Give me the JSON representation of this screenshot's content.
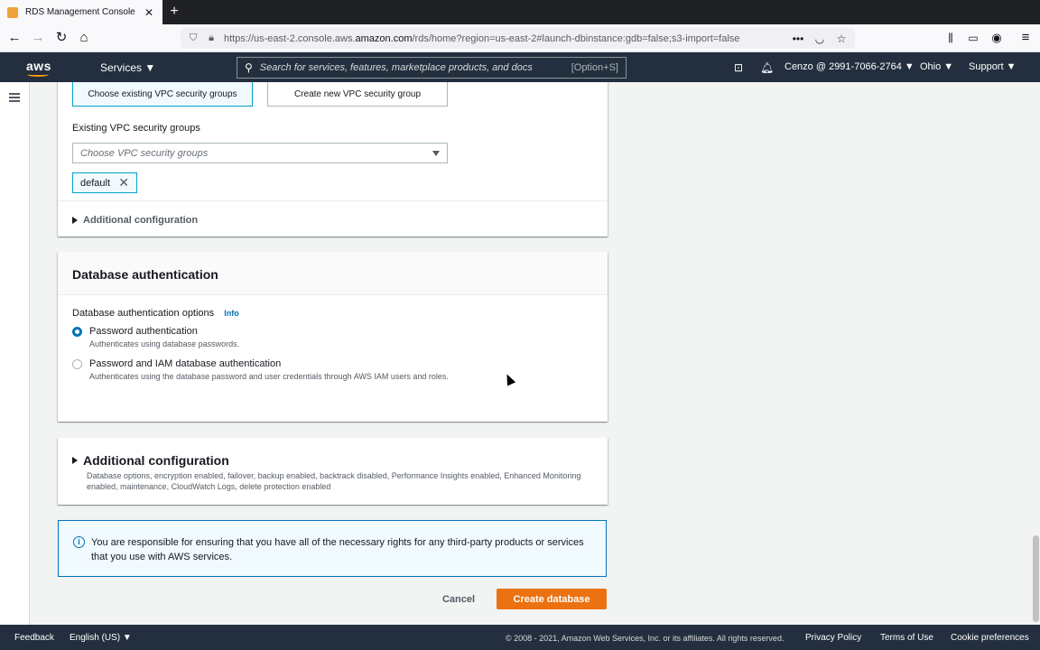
{
  "browser": {
    "tab_title": "RDS Management Console",
    "url_prefix": "https://us-east-2.console.aws.",
    "url_domain": "amazon.com",
    "url_suffix": "/rds/home?region=us-east-2#launch-dbinstance:gdb=false;s3-import=false"
  },
  "aws_header": {
    "logo": "aws",
    "services": "Services ▼",
    "search_placeholder": "Search for services, features, marketplace products, and docs",
    "search_shortcut": "[Option+S]",
    "account": "Cenzo @ 2991-7066-2764 ▼",
    "region": "Ohio ▼",
    "support": "Support ▼"
  },
  "security_groups": {
    "choose_existing": "Choose existing VPC security groups",
    "create_new": "Create new VPC security group",
    "existing_label": "Existing VPC security groups",
    "select_placeholder": "Choose VPC security groups",
    "selected_token": "default",
    "additional_configuration": "Additional configuration"
  },
  "db_auth": {
    "title": "Database authentication",
    "options_label": "Database authentication options",
    "info": "Info",
    "options": [
      {
        "title": "Password authentication",
        "desc": "Authenticates using database passwords.",
        "checked": true
      },
      {
        "title": "Password and IAM database authentication",
        "desc": "Authenticates using the database password and user credentials through AWS IAM users and roles.",
        "checked": false
      }
    ]
  },
  "additional": {
    "title": "Additional configuration",
    "desc": "Database options, encryption enabled, failover, backup enabled, backtrack disabled, Performance Insights enabled, Enhanced Monitoring enabled, maintenance, CloudWatch Logs, delete protection enabled"
  },
  "alert": {
    "text": "You are responsible for ensuring that you have all of the necessary rights for any third-party products or services that you use with AWS services."
  },
  "actions": {
    "cancel": "Cancel",
    "create": "Create database"
  },
  "footer": {
    "feedback": "Feedback",
    "language": "English (US) ▼",
    "copyright": "© 2008 - 2021, Amazon Web Services, Inc. or its affiliates. All rights reserved.",
    "privacy": "Privacy Policy",
    "terms": "Terms of Use",
    "cookies": "Cookie preferences"
  },
  "colors": {
    "aws_navy": "#232f3e",
    "primary_orange": "#ec7211",
    "link_blue": "#0073bb"
  }
}
